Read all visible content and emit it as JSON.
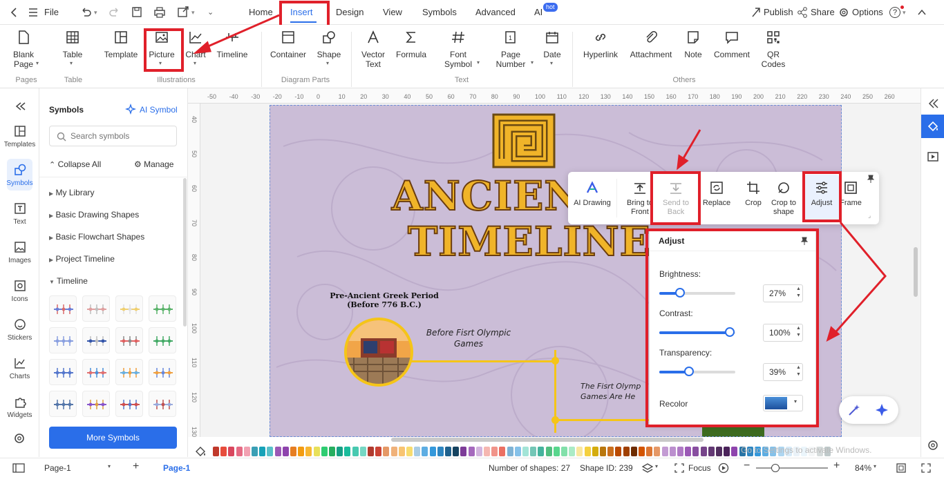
{
  "menu": {
    "file": "File",
    "tabs": [
      "Home",
      "Insert",
      "Design",
      "View",
      "Symbols",
      "Advanced",
      "AI"
    ],
    "active_tab": "Insert",
    "ai_badge": "hot",
    "publish": "Publish",
    "share": "Share",
    "options": "Options",
    "help": "?"
  },
  "ribbon": {
    "buttons": {
      "blank_page": "Blank\nPage",
      "table": "Table",
      "template": "Template",
      "picture": "Picture",
      "chart": "Chart",
      "timeline": "Timeline",
      "container": "Container",
      "shape": "Shape",
      "vector_text": "Vector\nText",
      "formula": "Formula",
      "font_symbol": "Font\nSymbol",
      "page_number": "Page\nNumber",
      "date": "Date",
      "hyperlink": "Hyperlink",
      "attachment": "Attachment",
      "note": "Note",
      "comment": "Comment",
      "qr_codes": "QR\nCodes"
    },
    "groups": {
      "pages": "Pages",
      "table": "Table",
      "illustrations": "Illustrations",
      "diagram_parts": "Diagram Parts",
      "text": "Text",
      "others": "Others"
    }
  },
  "left_strip": {
    "items": [
      "Templates",
      "Symbols",
      "Text",
      "Images",
      "Icons",
      "Stickers",
      "Charts",
      "Widgets"
    ],
    "active": "Symbols"
  },
  "symbols_panel": {
    "title": "Symbols",
    "ai_symbol": "AI Symbol",
    "search_placeholder": "Search symbols",
    "collapse_all": "Collapse All",
    "manage": "Manage",
    "tree": [
      "My Library",
      "Basic Drawing Shapes",
      "Basic Flowchart Shapes",
      "Project Timeline",
      "Timeline"
    ],
    "more_symbols": "More Symbols"
  },
  "ruler": {
    "top": [
      "-50",
      "-40",
      "-30",
      "-20",
      "-10",
      "0",
      "10",
      "20",
      "30",
      "40",
      "50",
      "60",
      "70",
      "80",
      "90",
      "100",
      "110",
      "120",
      "130",
      "140",
      "150",
      "160",
      "170",
      "180",
      "190",
      "200",
      "210",
      "220",
      "230",
      "240",
      "250",
      "260"
    ],
    "left": [
      "40",
      "50",
      "60",
      "70",
      "80",
      "90",
      "100",
      "110",
      "120",
      "130"
    ]
  },
  "canvas": {
    "title_line1": "ANCIENTG",
    "title_line2": "TIMELINE",
    "period_title": "Pre-Ancient Greek Period\n(Before 776 B.C.)",
    "event1": "Before Fisrt Olympic\nGames",
    "event2": "The Fisrt Olymp\nGames Are He"
  },
  "float_toolbar": {
    "items": [
      "AI Drawing",
      "Bring to\nFront",
      "Send to\nBack",
      "Replace",
      "Crop",
      "Crop to\nshape",
      "Adjust",
      "Frame"
    ]
  },
  "adjust_panel": {
    "title": "Adjust",
    "brightness_label": "Brightness:",
    "brightness_value": "27%",
    "brightness_level": 0.27,
    "contrast_label": "Contrast:",
    "contrast_value": "100%",
    "contrast_level": 0.93,
    "transparency_label": "Transparency:",
    "transparency_value": "39%",
    "transparency_level": 0.39,
    "recolor_label": "Recolor"
  },
  "colors": {
    "accent": "#2a6ee9",
    "annotation_red": "#e0202a",
    "page_bg": "#cbbdd7",
    "title_gold": "#f0b429",
    "timeline_line": "#f5c518",
    "palette": [
      "#c0392b",
      "#e74c3c",
      "#d9475e",
      "#e56b84",
      "#f2a1b2",
      "#3a9fb5",
      "#17a2b8",
      "#58c0c9",
      "#9b59b6",
      "#8e44ad",
      "#e67e22",
      "#f39c12",
      "#f7b733",
      "#e8e05a",
      "#2ecc71",
      "#27ae60",
      "#16a085",
      "#1abc9c",
      "#48c9b0",
      "#76d7c4",
      "#b03a2e",
      "#cb4335",
      "#e59866",
      "#f0b27a",
      "#f8c471",
      "#f7dc6f",
      "#a9cce3",
      "#5dade2",
      "#3498db",
      "#2e86c1",
      "#1f618d",
      "#154360",
      "#7d3c98",
      "#a569bd",
      "#d2b4de",
      "#f5b7b1",
      "#f1948a",
      "#ec7063",
      "#7fb3d5",
      "#85c1e9",
      "#a3e4d7",
      "#73c6b6",
      "#45b39d",
      "#52be80",
      "#58d68d",
      "#82e0aa",
      "#abebc6",
      "#f9e79f",
      "#f4d03f",
      "#d4ac0d",
      "#b9770e",
      "#ca6f1e",
      "#ba4a00",
      "#a04000",
      "#6e2c00",
      "#d35400",
      "#dc7633",
      "#e59866",
      "#c39bd3",
      "#bb8fce",
      "#af7ac5",
      "#9b59b6",
      "#884ea0",
      "#76448a",
      "#633974",
      "#512e5f",
      "#4a235a",
      "#8e44ad",
      "#2874a6",
      "#2e86c1",
      "#3498db",
      "#5dade2",
      "#85c1e9",
      "#aed6f1",
      "#d6eaf8",
      "#eaf2f8",
      "#ebf5fb",
      "#f4f6f7",
      "#d5dbdb",
      "#bfc9ca",
      "#aab7b8",
      "#95a5a6",
      "#7f8c8d",
      "#717d7e",
      "#616a6b",
      "#515a5a",
      "#424949",
      "#333333"
    ]
  },
  "status": {
    "page_select": "Page-1",
    "page_tab": "Page-1",
    "shape_count": "Number of shapes: 27",
    "shape_id": "Shape ID: 239",
    "focus": "Focus",
    "zoom": "84%",
    "watermark": "Go to Settings to activate Windows."
  }
}
